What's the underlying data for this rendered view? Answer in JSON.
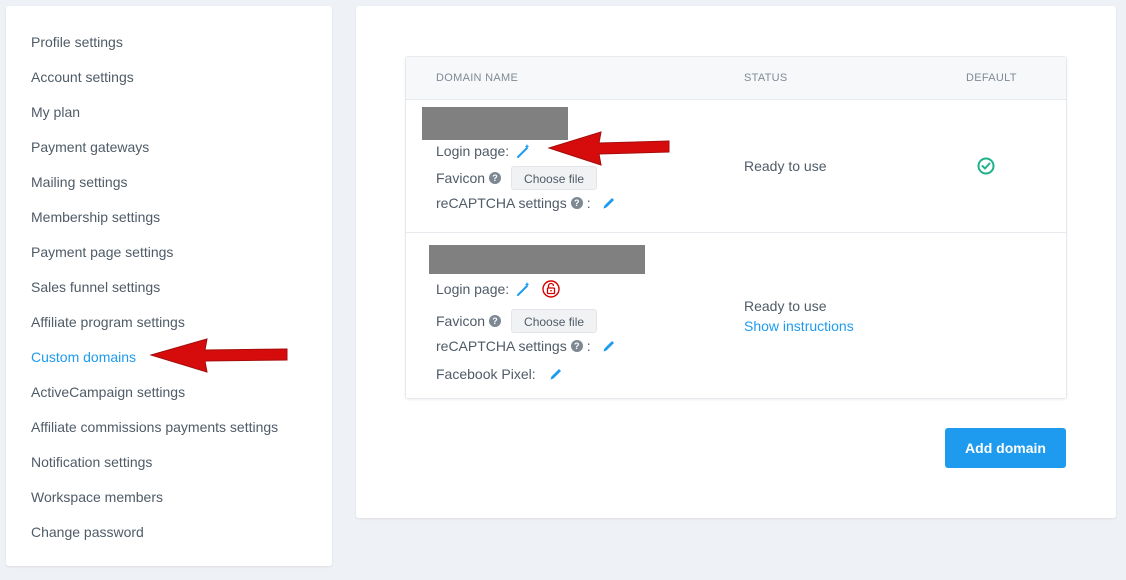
{
  "sidebar": {
    "items": [
      {
        "label": "Profile settings"
      },
      {
        "label": "Account settings"
      },
      {
        "label": "My plan"
      },
      {
        "label": "Payment gateways"
      },
      {
        "label": "Mailing settings"
      },
      {
        "label": "Membership settings"
      },
      {
        "label": "Payment page settings"
      },
      {
        "label": "Sales funnel settings"
      },
      {
        "label": "Affiliate program settings"
      },
      {
        "label": "Custom domains"
      },
      {
        "label": "ActiveCampaign settings"
      },
      {
        "label": "Affiliate commissions payments settings"
      },
      {
        "label": "Notification settings"
      },
      {
        "label": "Workspace members"
      },
      {
        "label": "Change password"
      }
    ],
    "active_index": 9
  },
  "table": {
    "headers": {
      "domain": "DOMAIN NAME",
      "status": "STATUS",
      "default": "DEFAULT"
    },
    "rows": [
      {
        "login_page_label": "Login page:",
        "favicon_label": "Favicon",
        "choose_file": "Choose file",
        "recaptcha_label": "reCAPTCHA settings",
        "colon": ":",
        "status": "Ready to use",
        "is_default": true
      },
      {
        "login_page_label": "Login page:",
        "favicon_label": "Favicon",
        "choose_file": "Choose file",
        "recaptcha_label": "reCAPTCHA settings",
        "colon": ":",
        "facebook_pixel_label": "Facebook Pixel:",
        "status": "Ready to use",
        "status_link": "Show instructions",
        "is_default": false
      }
    ]
  },
  "add_domain_label": "Add domain",
  "colors": {
    "accent": "#1e9bef",
    "success": "#1fb28b",
    "annotation": "#d40000"
  }
}
